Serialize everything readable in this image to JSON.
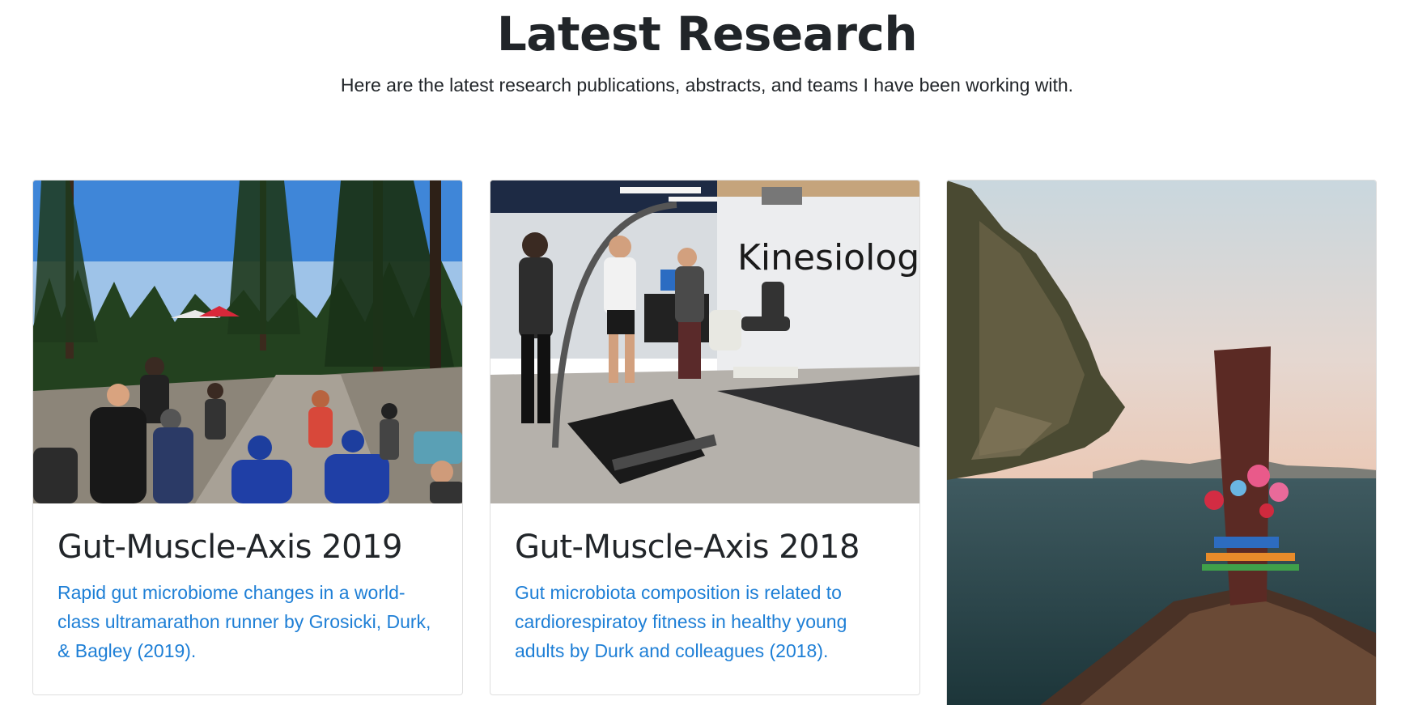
{
  "section": {
    "title": "Latest Research",
    "subtitle": "Here are the latest research publications, abstracts, and teams I have been working with."
  },
  "cards": [
    {
      "title": "Gut-Muscle-Axis 2019",
      "link_text": "Rapid gut microbiome changes in a world-class ultramarathon runner by Grosicki, Durk, & Bagley (2019).",
      "image_subject": "ultramarathon race crowd in forest"
    },
    {
      "title": "Gut-Muscle-Axis 2018",
      "link_text": "Gut microbiota composition is related to cardiorespiratoy fitness in healthy young adults by Durk and colleagues (2018).",
      "image_subject": "kinesiology lab treadmill test",
      "image_sign_text": "Kinesiolog"
    },
    {
      "image_subject": "longtail boat bow near limestone cliff at sea"
    }
  ],
  "colors": {
    "link": "#1e7fd6",
    "text": "#212529",
    "card_border": "#dfdfdf"
  }
}
